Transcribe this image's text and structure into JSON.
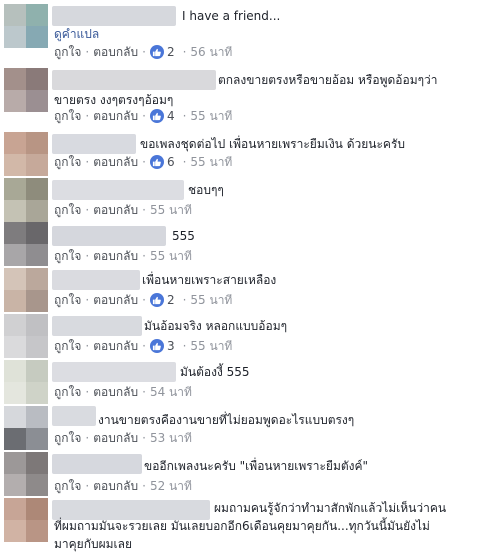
{
  "labels": {
    "like": "ถูกใจ",
    "reply": "ตอบกลับ",
    "dot": "·",
    "translate": "ดูคำแปล"
  },
  "colors": {
    "like_badge": "#4a76d8",
    "action": "#4b4f56",
    "meta": "#90949c"
  },
  "comments": [
    {
      "lines": [
        "I have a friend..."
      ],
      "reactions": "2",
      "time": "56 นาที"
    },
    {
      "lines": [
        "ตกลงขายตรงหรือขายอ้อม หรือพูดอ้อมๆว่า",
        "ขายตรง งงๆตรงๆอ้อมๆ"
      ],
      "reactions": "4",
      "time": "55 นาที"
    },
    {
      "lines": [
        "ขอเพลงชุดต่อไป เพื่อนหายเพราะยืมเงิน ด้วยนะครับ"
      ],
      "reactions": "6",
      "time": "55 นาที"
    },
    {
      "lines": [
        "ชอบๆๆ"
      ],
      "time": "55 นาที"
    },
    {
      "lines": [
        "555"
      ],
      "time": "55 นาที"
    },
    {
      "lines": [
        "เพื่อนหายเพราะสายเหลือง"
      ],
      "reactions": "2",
      "time": "55 นาที"
    },
    {
      "lines": [
        "มันอ้อมจริง หลอกแบบอ้อมๆ"
      ],
      "reactions": "3",
      "time": "55 นาที"
    },
    {
      "lines": [
        "มันต้องงี้ 555"
      ],
      "time": "54 นาที"
    },
    {
      "lines": [
        "งานขายตรงคืองานขายที่ไม่ยอมพูดอะไรแบบตรงๆ"
      ],
      "time": "53 นาที"
    },
    {
      "lines": [
        "ขออีกเพลงนะครับ \"เพื่อนหายเพราะยืมตังค์\""
      ],
      "time": "52 นาที"
    },
    {
      "lines": [
        "ผมถามคนรู้จักว่าทำมาสักพักแล้วไม่เห็นว่าคน",
        "ที่ผมถามมันจะรวยเลย มันเลยบอกอีก6เดือนคุยมาคุยกัน...ทุกวันนี้มันยังไม่",
        "มาคุยกับผมเลย"
      ]
    }
  ]
}
